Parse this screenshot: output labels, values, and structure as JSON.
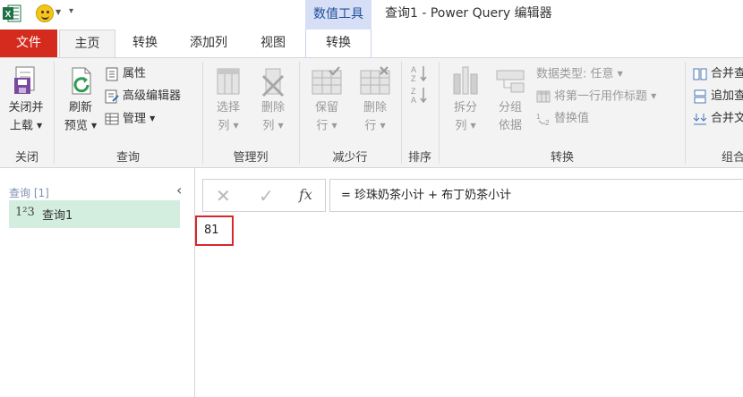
{
  "app": {
    "context_tab_title": "数值工具",
    "window_title": "查询1 - Power Query 编辑器"
  },
  "tabs": {
    "file": "文件",
    "home": "主页",
    "transform": "转换",
    "add_column": "添加列",
    "view": "视图",
    "context_transform": "转换"
  },
  "ribbon": {
    "close_group": {
      "label": "关闭",
      "close_load_line1": "关闭并",
      "close_load_line2": "上载"
    },
    "query_group": {
      "label": "查询",
      "refresh_line1": "刷新",
      "refresh_line2": "预览",
      "properties": "属性",
      "advanced_editor": "高级编辑器",
      "manage": "管理"
    },
    "manage_columns_group": {
      "label": "管理列",
      "choose_line1": "选择",
      "choose_line2": "列",
      "remove_line1": "删除",
      "remove_line2": "列"
    },
    "reduce_rows_group": {
      "label": "减少行",
      "keep_line1": "保留",
      "keep_line2": "行",
      "remove_line1": "删除",
      "remove_line2": "行"
    },
    "sort_group": {
      "label": "排序"
    },
    "transform_group": {
      "label": "转换",
      "split_line1": "拆分",
      "split_line2": "列",
      "group_line1": "分组",
      "group_line2": "依据",
      "data_type": "数据类型: 任意",
      "first_row_headers": "将第一行用作标题",
      "replace_values": "替换值"
    },
    "combine_group": {
      "label": "组合",
      "merge": "合并查",
      "append": "追加查",
      "combine_files": "合并文"
    }
  },
  "queries_pane": {
    "header": "查询 [1]",
    "items": [
      {
        "type_icon": "1²3",
        "name": "查询1"
      }
    ]
  },
  "formula_bar": {
    "fx": "fx",
    "formula": "= 珍珠奶茶小计 + 布丁奶茶小计"
  },
  "result": {
    "value": "81"
  },
  "colors": {
    "file_tab": "#d42b1e",
    "context_tab_bg": "#d6dff5",
    "selected_query_bg": "#d3eddf",
    "result_border": "#d9272e"
  }
}
